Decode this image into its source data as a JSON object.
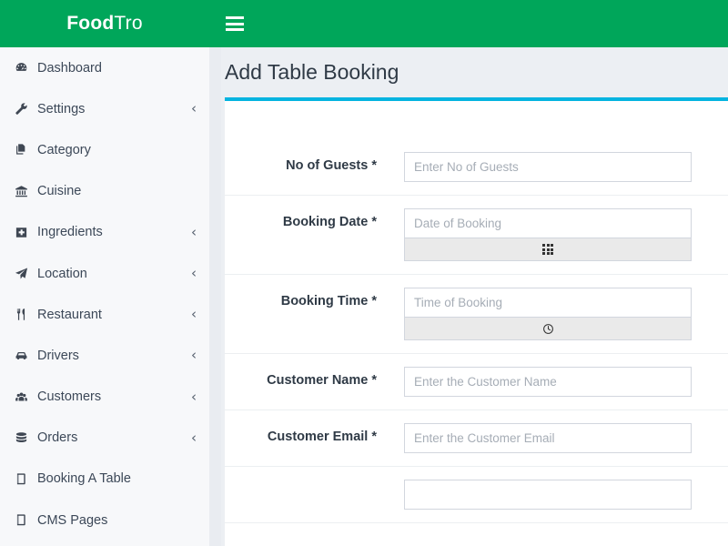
{
  "brand": {
    "strong": "Food",
    "light": "Tro"
  },
  "topbar": {
    "menu_toggle_name": "hamburger-icon"
  },
  "colors": {
    "header_green": "#00a65a",
    "card_accent": "#04b4e0",
    "sidebar_bg": "#f7f8fa",
    "content_bg": "#eceff3",
    "text_dark": "#2f3a46"
  },
  "sidebar": {
    "items": [
      {
        "label": "Dashboard",
        "icon": "dashboard-icon",
        "arrow": ""
      },
      {
        "label": "Settings",
        "icon": "wrench-icon",
        "arrow": "‹"
      },
      {
        "label": "Category",
        "icon": "copy-icon",
        "arrow": ""
      },
      {
        "label": "Cuisine",
        "icon": "bank-icon",
        "arrow": ""
      },
      {
        "label": "Ingredients",
        "icon": "plus-square-icon",
        "arrow": "‹"
      },
      {
        "label": "Location",
        "icon": "paper-plane-icon",
        "arrow": "‹"
      },
      {
        "label": "Restaurant",
        "icon": "cutlery-icon",
        "arrow": "‹"
      },
      {
        "label": "Drivers",
        "icon": "car-icon",
        "arrow": "‹"
      },
      {
        "label": "Customers",
        "icon": "users-icon",
        "arrow": "‹"
      },
      {
        "label": "Orders",
        "icon": "database-icon",
        "arrow": "‹"
      },
      {
        "label": "Booking A Table",
        "icon": "book-icon",
        "arrow": ""
      },
      {
        "label": "CMS Pages",
        "icon": "book-icon",
        "arrow": ""
      }
    ]
  },
  "page": {
    "title": "Add Table Booking"
  },
  "form": {
    "fields": [
      {
        "label": "No of Guests *",
        "placeholder": "Enter No of Guests",
        "value": "",
        "type": "text",
        "name": "no-of-guests"
      },
      {
        "label": "Booking Date *",
        "placeholder": "Date of Booking",
        "value": "",
        "type": "datepicker",
        "name": "booking-date",
        "picker_icon": "calendar-grid-icon"
      },
      {
        "label": "Booking Time *",
        "placeholder": "Time of Booking",
        "value": "",
        "type": "timepicker",
        "name": "booking-time",
        "picker_icon": "clock-icon"
      },
      {
        "label": "Customer Name *",
        "placeholder": "Enter the Customer Name",
        "value": "",
        "type": "text",
        "name": "customer-name"
      },
      {
        "label": "Customer Email *",
        "placeholder": "Enter the Customer Email",
        "value": "",
        "type": "text",
        "name": "customer-email"
      },
      {
        "label": "",
        "placeholder": "",
        "value": "",
        "type": "text",
        "name": "next-field-partial"
      }
    ]
  }
}
